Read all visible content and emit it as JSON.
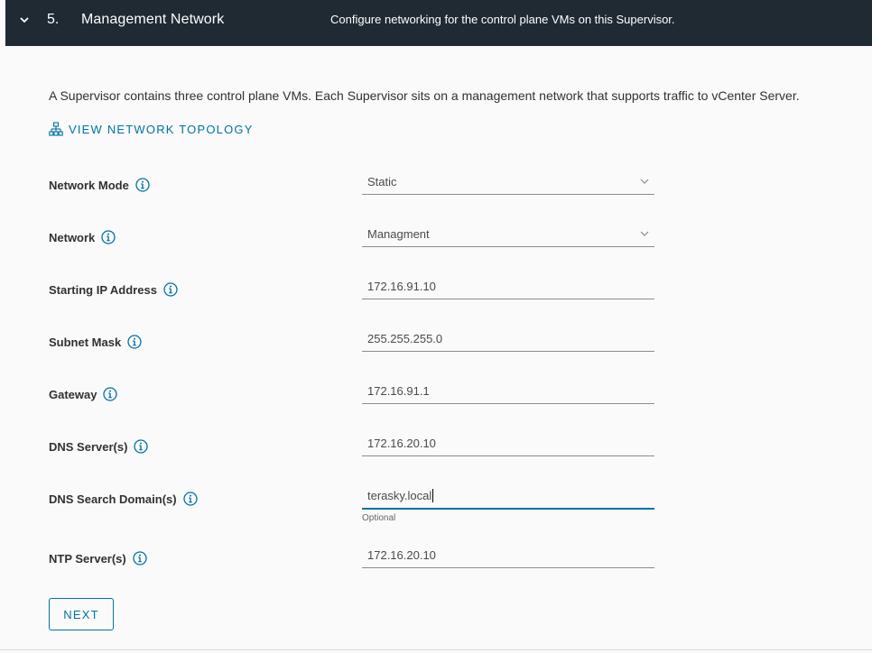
{
  "header": {
    "step_number": "5.",
    "title": "Management Network",
    "description": "Configure networking for the control plane VMs on this Supervisor."
  },
  "intro_text": "A Supervisor contains three control plane VMs. Each Supervisor sits on a management network that supports traffic to vCenter Server.",
  "topology_link": {
    "label": "VIEW NETWORK TOPOLOGY",
    "icon": "network-topology-icon"
  },
  "form": {
    "network_mode": {
      "label": "Network Mode",
      "value": "Static"
    },
    "network": {
      "label": "Network",
      "value": "Managment"
    },
    "starting_ip": {
      "label": "Starting IP Address",
      "value": "172.16.91.10"
    },
    "subnet_mask": {
      "label": "Subnet Mask",
      "value": "255.255.255.0"
    },
    "gateway": {
      "label": "Gateway",
      "value": "172.16.91.1"
    },
    "dns_servers": {
      "label": "DNS Server(s)",
      "value": "172.16.20.10"
    },
    "dns_search_domains": {
      "label": "DNS Search Domain(s)",
      "value": "terasky.local",
      "helper": "Optional"
    },
    "ntp_servers": {
      "label": "NTP Server(s)",
      "value": "172.16.20.10"
    }
  },
  "next_button": {
    "label": "NEXT"
  },
  "colors": {
    "header_bg": "#1f2a33",
    "accent": "#0072a3",
    "spellcheck": "#e02020"
  }
}
